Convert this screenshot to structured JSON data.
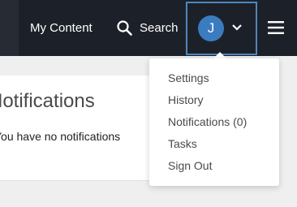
{
  "header": {
    "my_content_label": "My Content",
    "search_label": "Search",
    "user_initial": "J",
    "avatar_color": "#3b7bbf",
    "background_color": "#1c2129"
  },
  "user_menu": {
    "items": [
      {
        "label": "Settings"
      },
      {
        "label": "History"
      },
      {
        "label": "Notifications (0)"
      },
      {
        "label": "Tasks"
      },
      {
        "label": "Sign Out"
      }
    ]
  },
  "notifications_panel": {
    "title": "Notifications",
    "empty_text": "You have no notifications"
  },
  "icons": {
    "search": "search-icon",
    "chevron": "chevron-down-icon",
    "menu": "hamburger-menu-icon"
  }
}
